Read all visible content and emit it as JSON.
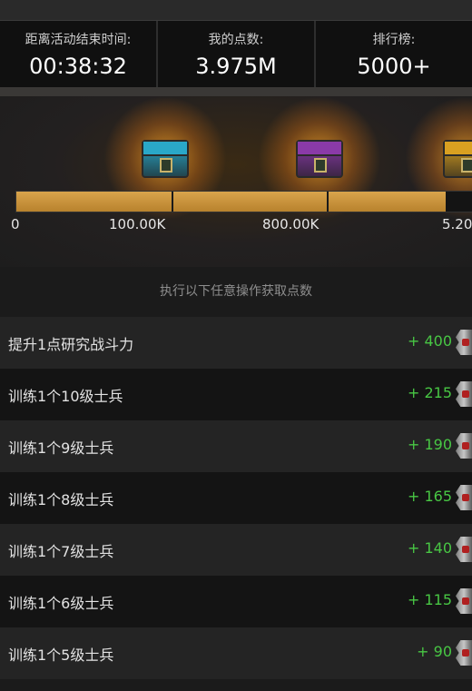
{
  "stats": {
    "time_left": {
      "label": "距离活动结束时间:",
      "value": "00:38:32"
    },
    "my_points": {
      "label": "我的点数:",
      "value": "3.975M"
    },
    "ranking": {
      "label": "排行榜:",
      "value": "5000+"
    }
  },
  "rewards": {
    "progress_fraction": 0.94,
    "chests": [
      {
        "name": "blue-chest",
        "color": "#2aa8c8"
      },
      {
        "name": "purple-chest",
        "color": "#8a3aa8"
      },
      {
        "name": "gold-chest",
        "color": "#d9a021"
      }
    ],
    "ticks": [
      "0",
      "100.00K",
      "800.00K",
      "5.20"
    ]
  },
  "actions": {
    "title": "执行以下任意操作获取点数",
    "items": [
      {
        "label": "提升1点研究战斗力",
        "points": "+ 400"
      },
      {
        "label": "训练1个10级士兵",
        "points": "+ 215"
      },
      {
        "label": "训练1个9级士兵",
        "points": "+ 190"
      },
      {
        "label": "训练1个8级士兵",
        "points": "+ 165"
      },
      {
        "label": "训练1个7级士兵",
        "points": "+ 140"
      },
      {
        "label": "训练1个6级士兵",
        "points": "+ 115"
      },
      {
        "label": "训练1个5级士兵",
        "points": "+ 90"
      }
    ]
  },
  "colors": {
    "points_green": "#48c744",
    "progress_gold": "#d9a44c"
  }
}
